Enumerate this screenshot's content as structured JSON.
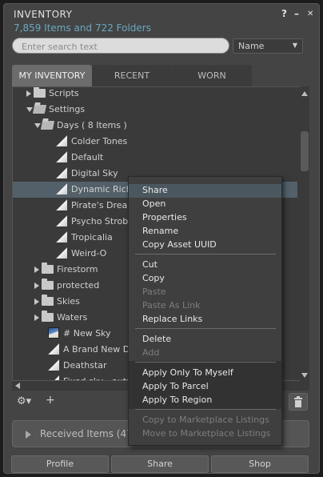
{
  "window": {
    "title": "INVENTORY",
    "help": "?",
    "minimize": "–",
    "close": "✕",
    "item_count": "7,859 Items and 722 Folders"
  },
  "search": {
    "placeholder": "Enter search text",
    "value": ""
  },
  "sort": {
    "value": "Name"
  },
  "tabs": [
    "MY INVENTORY",
    "RECENT",
    "WORN"
  ],
  "tree": [
    {
      "label": "Scripts",
      "type": "folder",
      "state": "closed",
      "level": 1
    },
    {
      "label": "Settings",
      "type": "folder",
      "state": "open",
      "level": 1
    },
    {
      "label": "Days ( 8 Items )",
      "type": "folder",
      "state": "open",
      "level": 2
    },
    {
      "label": "Colder Tones",
      "type": "day",
      "level": 3
    },
    {
      "label": "Default",
      "type": "day",
      "level": 3
    },
    {
      "label": "Digital Sky",
      "type": "day",
      "level": 3
    },
    {
      "label": "Dynamic Richne",
      "type": "day",
      "level": 3,
      "selected": true
    },
    {
      "label": "Pirate's Dream",
      "type": "day",
      "level": 3
    },
    {
      "label": "Psycho Strobe!",
      "type": "day",
      "level": 3
    },
    {
      "label": "Tropicalia",
      "type": "day",
      "level": 3
    },
    {
      "label": "Weird-O",
      "type": "day",
      "level": 3
    },
    {
      "label": "Firestorm",
      "type": "folder",
      "state": "closed",
      "level": 2
    },
    {
      "label": "protected",
      "type": "folder",
      "state": "closed",
      "level": 2
    },
    {
      "label": "Skies",
      "type": "folder",
      "state": "closed",
      "level": 2
    },
    {
      "label": "Waters",
      "type": "folder",
      "state": "closed",
      "level": 2
    },
    {
      "label": "# New Sky",
      "type": "sky",
      "level": 2
    },
    {
      "label": "A Brand New Day",
      "type": "day",
      "level": 2
    },
    {
      "label": "Deathstar",
      "type": "day",
      "level": 2
    },
    {
      "label": "Fixed sky - autum",
      "type": "day",
      "level": 2
    }
  ],
  "context_menu": {
    "items": [
      {
        "label": "Share",
        "enabled": true,
        "highlighted": true
      },
      {
        "label": "Open",
        "enabled": true
      },
      {
        "label": "Properties",
        "enabled": true
      },
      {
        "label": "Rename",
        "enabled": true
      },
      {
        "label": "Copy Asset UUID",
        "enabled": true
      },
      {
        "sep": true
      },
      {
        "label": "Cut",
        "enabled": true
      },
      {
        "label": "Copy",
        "enabled": true
      },
      {
        "label": "Paste",
        "enabled": false
      },
      {
        "label": "Paste As Link",
        "enabled": false
      },
      {
        "label": "Replace Links",
        "enabled": true
      },
      {
        "sep": true
      },
      {
        "label": "Delete",
        "enabled": true
      },
      {
        "label": "Add",
        "enabled": false
      },
      {
        "sep": true
      },
      {
        "label": "Apply Only To Myself",
        "enabled": true
      },
      {
        "label": "Apply To Parcel",
        "enabled": true
      },
      {
        "label": "Apply To Region",
        "enabled": true
      },
      {
        "sep": true
      },
      {
        "label": "Copy to Marketplace Listings",
        "enabled": false
      },
      {
        "label": "Move to Marketplace Listings",
        "enabled": false
      }
    ]
  },
  "toolbar": {
    "gear": "⚙▾",
    "add": "+",
    "trash": "🗑"
  },
  "received": {
    "label": "Received Items (47"
  },
  "bottom_buttons": [
    "Profile",
    "Share",
    "Shop"
  ]
}
